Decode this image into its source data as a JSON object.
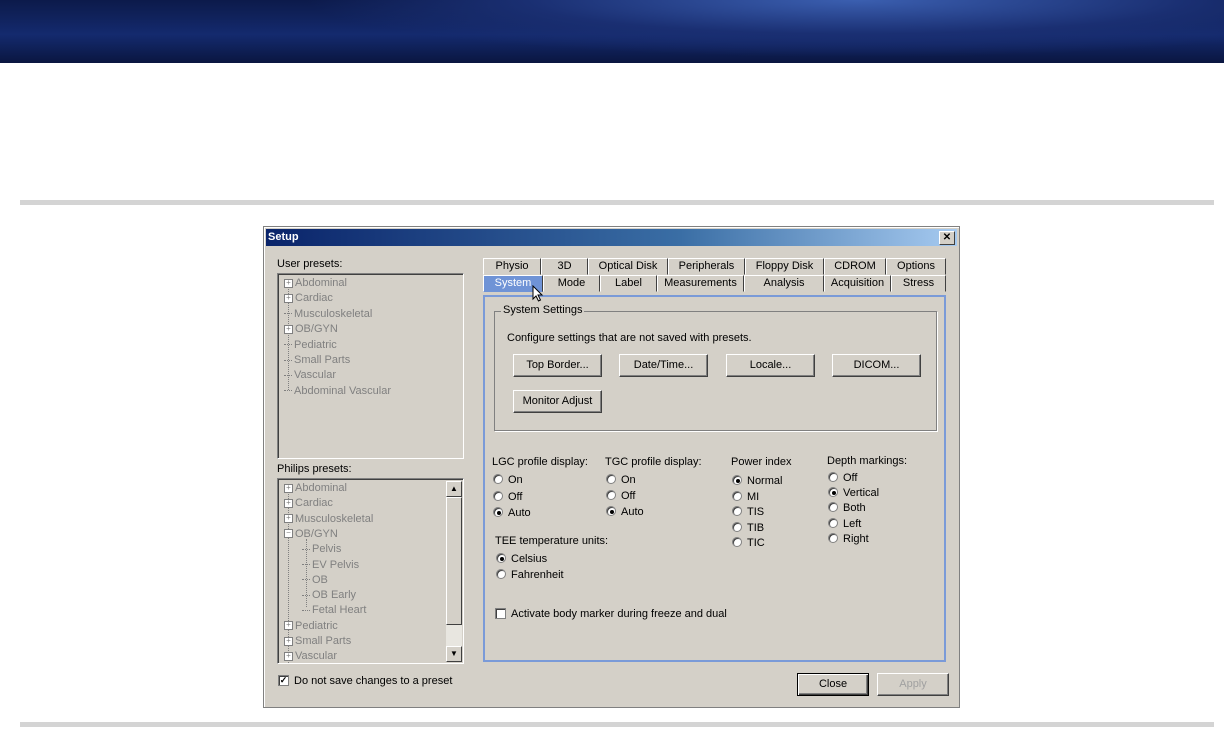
{
  "dialog": {
    "title": "Setup",
    "close_glyph": "✕",
    "user_presets_label": "User presets:",
    "philips_presets_label": "Philips presets:",
    "user_presets": [
      {
        "label": "Abdominal",
        "expandable": true
      },
      {
        "label": "Cardiac",
        "expandable": true
      },
      {
        "label": "Musculoskeletal",
        "expandable": false
      },
      {
        "label": "OB/GYN",
        "expandable": true
      },
      {
        "label": "Pediatric",
        "expandable": false
      },
      {
        "label": "Small Parts",
        "expandable": false
      },
      {
        "label": "Vascular",
        "expandable": false
      },
      {
        "label": "Abdominal Vascular",
        "expandable": false
      }
    ],
    "philips_presets": [
      {
        "label": "Abdominal",
        "state": "collapsed"
      },
      {
        "label": "Cardiac",
        "state": "collapsed"
      },
      {
        "label": "Musculoskeletal",
        "state": "collapsed"
      },
      {
        "label": "OB/GYN",
        "state": "expanded"
      },
      {
        "label": "Pelvis",
        "state": "child"
      },
      {
        "label": "EV Pelvis",
        "state": "child"
      },
      {
        "label": "OB",
        "state": "child"
      },
      {
        "label": "OB Early",
        "state": "child"
      },
      {
        "label": "Fetal Heart",
        "state": "child"
      },
      {
        "label": "Pediatric",
        "state": "collapsed"
      },
      {
        "label": "Small Parts",
        "state": "collapsed"
      },
      {
        "label": "Vascular",
        "state": "collapsed"
      }
    ],
    "tabs_row1": [
      "Physio",
      "3D",
      "Optical Disk",
      "Peripherals",
      "Floppy Disk",
      "CDROM",
      "Options"
    ],
    "tabs_row2": [
      "System",
      "Mode",
      "Label",
      "Measurements",
      "Analysis",
      "Acquisition",
      "Stress"
    ],
    "active_tab": "System",
    "system_settings": {
      "group_title": "System Settings",
      "description": "Configure settings that are not saved with presets.",
      "buttons": [
        "Top Border...",
        "Date/Time...",
        "Locale...",
        "DICOM...",
        "Monitor Adjust"
      ]
    },
    "lgc": {
      "title": "LGC profile display:",
      "options": [
        "On",
        "Off",
        "Auto"
      ],
      "selected": "Auto"
    },
    "tgc": {
      "title": "TGC profile display:",
      "options": [
        "On",
        "Off",
        "Auto"
      ],
      "selected": "Auto"
    },
    "power": {
      "title": "Power index",
      "options": [
        "Normal",
        "MI",
        "TIS",
        "TIB",
        "TIC"
      ],
      "selected": "Normal"
    },
    "depth": {
      "title": "Depth markings:",
      "options": [
        "Off",
        "Vertical",
        "Both",
        "Left",
        "Right"
      ],
      "selected": "Vertical"
    },
    "tee": {
      "title": "TEE temperature units:",
      "options": [
        "Celsius",
        "Fahrenheit"
      ],
      "selected": "Celsius"
    },
    "body_marker_label": "Activate body marker during freeze and dual",
    "body_marker_checked": false,
    "no_save_label": "Do not save changes to a preset",
    "no_save_checked": true,
    "close_label": "Close",
    "apply_label": "Apply",
    "check_glyph": "✓",
    "scroll_up_glyph": "▲",
    "scroll_down_glyph": "▼"
  },
  "colors": {
    "active_tab": "#6f93d6",
    "panel_border": "#7a9ad8",
    "title_bar": "#0a246a"
  }
}
